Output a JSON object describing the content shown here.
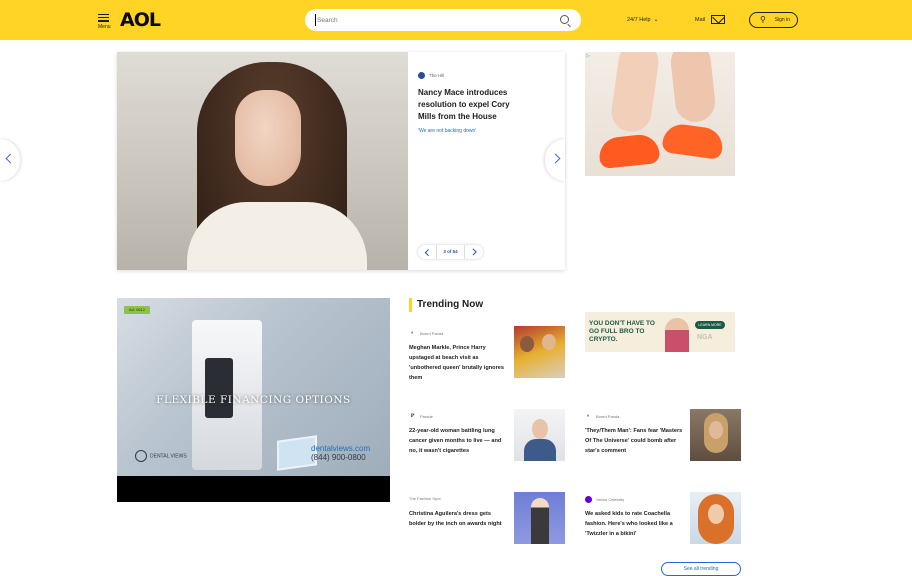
{
  "header": {
    "menu_label": "Menu",
    "logo_text": "AOL",
    "search_placeholder": "Search",
    "help_label": "24/7 Help",
    "mail_label": "Mail",
    "signin_label": "Sign in",
    "brand_color": "#ffd424"
  },
  "hero": {
    "source": "The Hill",
    "title": "Nancy Mace introduces resolution to expel Cory Mills from the House",
    "quote": "'We are not backing down'",
    "pager_label": "3 of 54",
    "accent_color": "#2468d8"
  },
  "ads": {
    "dental": {
      "badge": "Ad: 0612",
      "headline": "FLEXIBLE FINANCING OPTIONS",
      "brand": "DENTAL VIEWS",
      "url": "dentalviews.com",
      "phone": "(844) 900-0800"
    },
    "crypto": {
      "headline": "YOU DON'T HAVE TO GO FULL BRO TO CRYPTO.",
      "cta": "LEARN MORE",
      "brand": "NGA"
    }
  },
  "trending": {
    "heading": "Trending Now",
    "items": [
      {
        "source": "Bored Panda",
        "source_icon": "bored-panda-icon",
        "title": "Meghan Markle, Prince Harry upstaged at beach visit as 'unbothered queen' brutally ignores them",
        "thumb": "meghan"
      },
      {
        "source": "Parade",
        "source_icon": "parade-icon",
        "title": "22-year-old woman battling lung cancer given months to live — and no, it wasn't cigarettes",
        "thumb": "woman"
      },
      {
        "source": "The Fashion Spot",
        "source_icon": "",
        "title": "Christina Aguilera's dress gets bolder by the inch on awards night",
        "thumb": "christina"
      },
      {
        "source": "Bored Panda",
        "source_icon": "bored-panda-icon",
        "title": "'They/Them Man': Fans fear 'Masters Of The Universe' could bomb after star's comment",
        "thumb": "masters"
      },
      {
        "source": "Yahoo Celebrity",
        "source_icon": "yahoo-icon",
        "title": "We asked kids to rate Coachella fashion. Here's who looked like a 'Twizzler in a bikini'",
        "thumb": "coachella"
      }
    ],
    "see_more": "See all trending"
  }
}
